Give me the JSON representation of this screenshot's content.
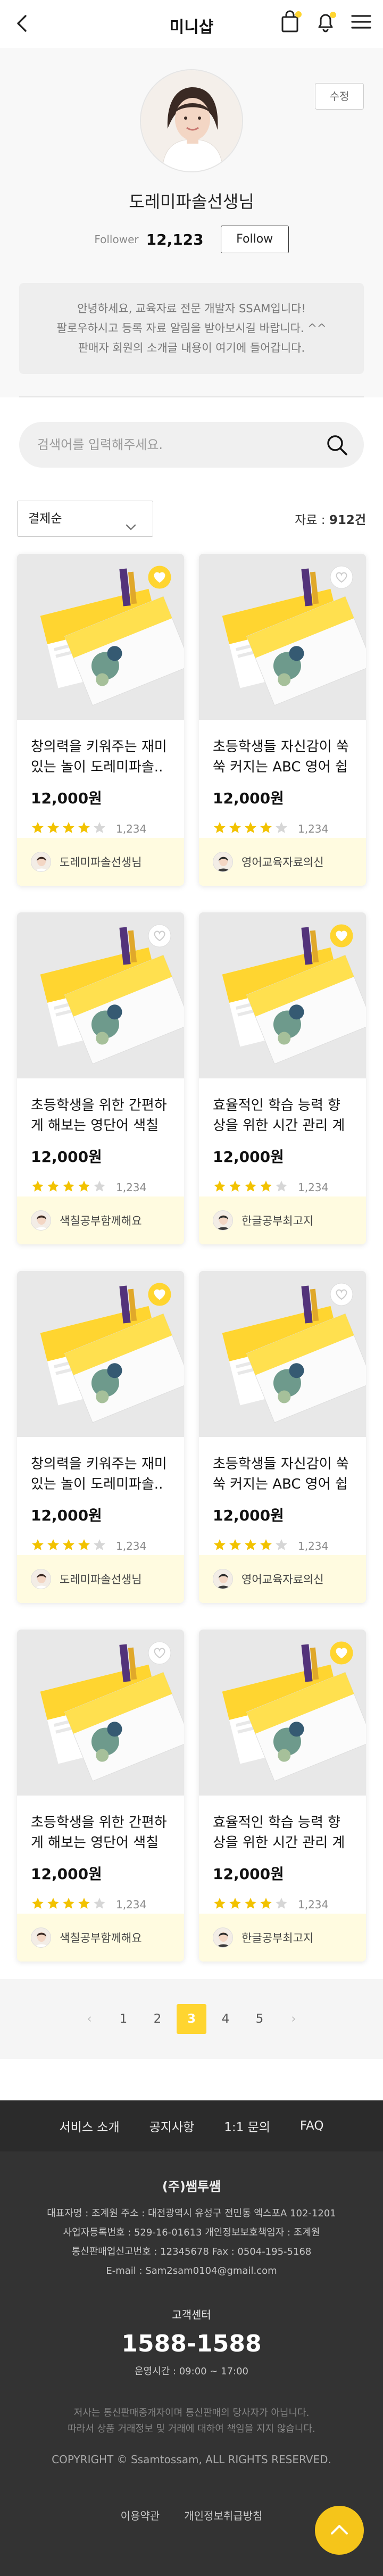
{
  "header": {
    "title": "미니샵"
  },
  "colors": {
    "accent": "#ffd530",
    "star": "#f2c200",
    "footer_bg": "#333333"
  },
  "profile": {
    "edit_label": "수정",
    "name": "도레미파솔선생님",
    "follower_label": "Follower",
    "follower_count": "12,123",
    "follow_button": "Follow",
    "intro_lines": [
      "안녕하세요, 교육자료 전문 개발자 SSAM입니다!",
      "팔로우하시고 등록 자료 알림을 받아보시길 바랍니다. ^^",
      "판매자 회원의 소개글 내용이 여기에 들어갑니다."
    ]
  },
  "search": {
    "placeholder": "검색어를 입력해주세요."
  },
  "filter": {
    "selected": "결제순",
    "count_label": "자료 : ",
    "count_value": "912건"
  },
  "products": [
    {
      "title": "창의력을 키워주는 재미있는 놀이 도레미파솔..",
      "price": "12,000원",
      "rating": 4,
      "review_count": "1,234",
      "seller": "도레미파솔선생님",
      "liked": true
    },
    {
      "title": "초등학생들 자신감이 쑥쑥 커지는 ABC 영어 쉽게..",
      "price": "12,000원",
      "rating": 4,
      "review_count": "1,234",
      "seller": "영어교육자료의신",
      "liked": false
    },
    {
      "title": "초등학생을 위한 간편하게 해보는 영단어 색칠 게임!",
      "price": "12,000원",
      "rating": 4,
      "review_count": "1,234",
      "seller": "색칠공부함께해요",
      "liked": false
    },
    {
      "title": "효율적인 학습 능력 향상을 위한 시간 관리 계획표..",
      "price": "12,000원",
      "rating": 4,
      "review_count": "1,234",
      "seller": "한글공부최고지",
      "liked": true
    },
    {
      "title": "창의력을 키워주는 재미있는 놀이 도레미파솔..",
      "price": "12,000원",
      "rating": 4,
      "review_count": "1,234",
      "seller": "도레미파솔선생님",
      "liked": true
    },
    {
      "title": "초등학생들 자신감이 쑥쑥 커지는 ABC 영어 쉽게..",
      "price": "12,000원",
      "rating": 4,
      "review_count": "1,234",
      "seller": "영어교육자료의신",
      "liked": false
    },
    {
      "title": "초등학생을 위한 간편하게 해보는 영단어 색칠 게임!",
      "price": "12,000원",
      "rating": 4,
      "review_count": "1,234",
      "seller": "색칠공부함께해요",
      "liked": false
    },
    {
      "title": "효율적인 학습 능력 향상을 위한 시간 관리 계획표..",
      "price": "12,000원",
      "rating": 4,
      "review_count": "1,234",
      "seller": "한글공부최고지",
      "liked": true
    }
  ],
  "pagination": {
    "prev": "‹",
    "pages": [
      "1",
      "2",
      "3",
      "4",
      "5"
    ],
    "current_page": "3",
    "next": "›"
  },
  "footer": {
    "nav": [
      "서비스 소개",
      "공지사항",
      "1:1 문의",
      "FAQ"
    ],
    "company": "(주)쌤투쌤",
    "info_lines": [
      "대표자명 : 조계원    주소 : 대전광역시 유성구 전민동 엑스포A 102-1201",
      "사업자등록번호 : 529-16-01613    개인정보보호책임자 : 조계원",
      "통신판매업신고번호 : 12345678    Fax : 0504-195-5168",
      "E-mail : Sam2sam0104@gmail.com"
    ],
    "cs_label": "고객센터",
    "cs_phone": "1588-1588",
    "cs_hours": "운영시간 : 09:00 ~ 17:00",
    "notice_lines": [
      "저사는 통신판매중개자이며 통신판매의 당사자가 아닙니다.",
      "따라서 상품 거래정보 및 거래에 대하여 책임을 지지 않습니다."
    ],
    "copyright": "COPYRIGHT © Ssamtossam, ALL RIGHTS RESERVED.",
    "links": [
      "이용약관",
      "개인정보취급방침"
    ]
  }
}
